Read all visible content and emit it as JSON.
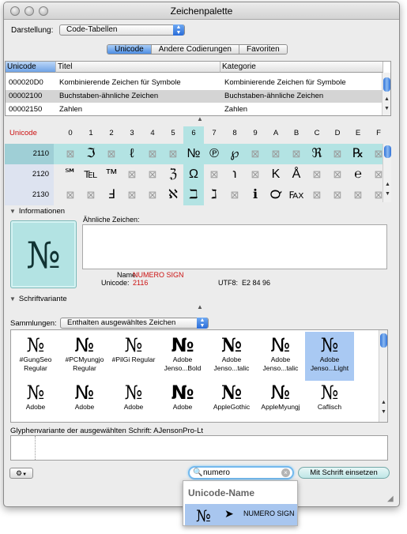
{
  "window": {
    "title": "Zeichenpalette"
  },
  "toolbar": {
    "view_label": "Darstellung:",
    "view_value": "Code-Tabellen",
    "tabs": [
      "Unicode",
      "Andere Codierungen",
      "Favoriten"
    ],
    "active_tab": "Unicode"
  },
  "block_table": {
    "headers": [
      "Unicode",
      "Titel",
      "Kategorie"
    ],
    "rows": [
      {
        "code": "000020D0",
        "title": "Kombinierende Zeichen für Symbole",
        "category": "Kombinierende Zeichen für Symbole"
      },
      {
        "code": "00002100",
        "title": "Buchstaben-ähnliche Zeichen",
        "category": "Buchstaben-ähnliche Zeichen"
      },
      {
        "code": "00002150",
        "title": "Zahlen",
        "category": "Zahlen"
      }
    ]
  },
  "char_grid": {
    "header_label": "Unicode",
    "columns": [
      "0",
      "1",
      "2",
      "3",
      "4",
      "5",
      "6",
      "7",
      "8",
      "9",
      "A",
      "B",
      "C",
      "D",
      "E",
      "F"
    ],
    "rows": [
      {
        "code": "2110",
        "chars": [
          "⊠",
          "ℑ",
          "⊠",
          "ℓ",
          "⊠",
          "⊠",
          "№",
          "℗",
          "℘",
          "⊠",
          "⊠",
          "⊠",
          "ℜ",
          "⊠",
          "℞",
          "⊠"
        ]
      },
      {
        "code": "2120",
        "chars": [
          "℠",
          "℡",
          "™",
          "⊠",
          "⊠",
          "ℨ",
          "Ω",
          "⊠",
          "℩",
          "⊠",
          "K",
          "Å",
          "⊠",
          "⊠",
          "℮",
          "⊠"
        ]
      },
      {
        "code": "2130",
        "chars": [
          "⊠",
          "⊠",
          "Ⅎ",
          "⊠",
          "⊠",
          "ℵ",
          "ℶ",
          "ℷ",
          "⊠",
          "ℹ",
          "℺",
          "℻",
          "⊠",
          "⊠",
          "⊠",
          "⊠"
        ]
      }
    ]
  },
  "info": {
    "section_label": "Informationen",
    "glyph": "№",
    "similar_label": "Ähnliche Zeichen:",
    "name_label": "Name:",
    "name_value": "NUMERO SIGN",
    "unicode_label": "Unicode:",
    "unicode_value": "2116",
    "utf8_label": "UTF8:",
    "utf8_value": "E2 84 96"
  },
  "fontvariant": {
    "section_label": "Schriftvariante",
    "collections_label": "Sammlungen:",
    "collections_value": "Enthalten ausgewähltes Zeichen",
    "fonts_row1": [
      {
        "glyph": "№",
        "name": "#GungSeo Regular"
      },
      {
        "glyph": "№",
        "name": "#PCMyungjo Regular"
      },
      {
        "glyph": "№",
        "name": "#PilGi Regular"
      },
      {
        "glyph": "№",
        "name": "Adobe Jenso...Bold"
      },
      {
        "glyph": "№",
        "name": "Adobe Jenso...talic"
      },
      {
        "glyph": "№",
        "name": "Adobe Jenso...talic"
      },
      {
        "glyph": "№",
        "name": "Adobe Jenso...Light"
      }
    ],
    "fonts_row2": [
      {
        "glyph": "№",
        "name": "Adobe"
      },
      {
        "glyph": "№",
        "name": "Adobe"
      },
      {
        "glyph": "№",
        "name": "Adobe"
      },
      {
        "glyph": "№",
        "name": "Adobe"
      },
      {
        "glyph": "№",
        "name": "AppleGothic"
      },
      {
        "glyph": "№",
        "name": "AppleMyungj"
      },
      {
        "glyph": "№",
        "name": "Caflisch"
      }
    ],
    "glyph_variant_label": "Glyphenvariante der ausgewählten Schrift:",
    "glyph_variant_font": "AJensonPro-Lt"
  },
  "bottom": {
    "search_value": "numero",
    "insert_button": "Mit Schrift einsetzen",
    "dropdown_header": "Unicode-Name",
    "dropdown_item_glyph": "№",
    "dropdown_item_name": "NUMERO SIGN"
  },
  "colors": {
    "accent": "#4d8ee3",
    "highlight_teal": "#b3e3e3",
    "red_text": "#cc1111"
  }
}
